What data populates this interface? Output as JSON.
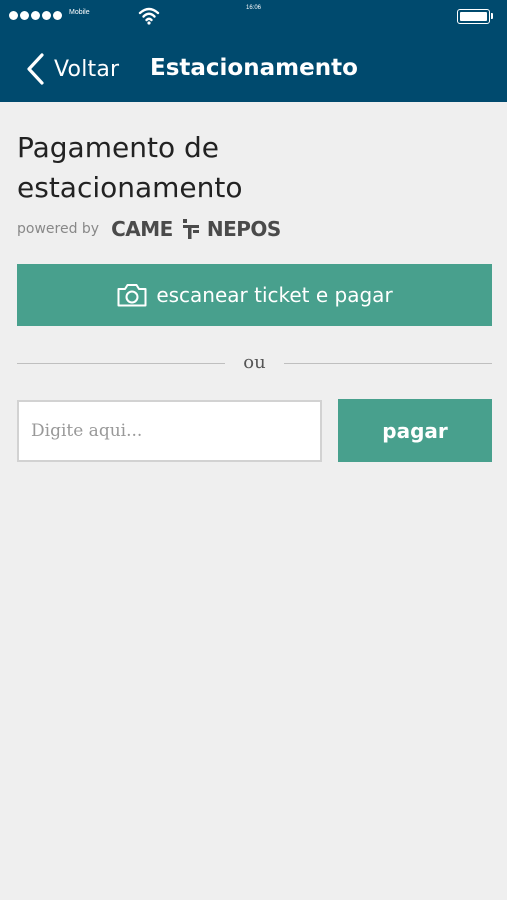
{
  "status_bar": {
    "carrier": "Mobile",
    "time": "16:06"
  },
  "nav": {
    "back_label": "Voltar",
    "title": "Estacionamento"
  },
  "main": {
    "title": "Pagamento de estacionamento",
    "powered_by": "powered by",
    "brand_left": "CAME",
    "brand_right": "NEPOS",
    "scan_label": "escanear ticket e pagar",
    "or_label": "ou",
    "input_placeholder": "Digite aqui...",
    "input_value": "",
    "pay_label": "pagar"
  },
  "colors": {
    "header": "#004a6e",
    "accent": "#48a08d",
    "background": "#efefef"
  },
  "icons": {
    "back": "chevron-left-icon",
    "scan": "camera-icon",
    "wifi": "wifi-icon",
    "battery": "battery-icon",
    "signal": "signal-dots-icon",
    "brand": "came-logo-icon"
  }
}
